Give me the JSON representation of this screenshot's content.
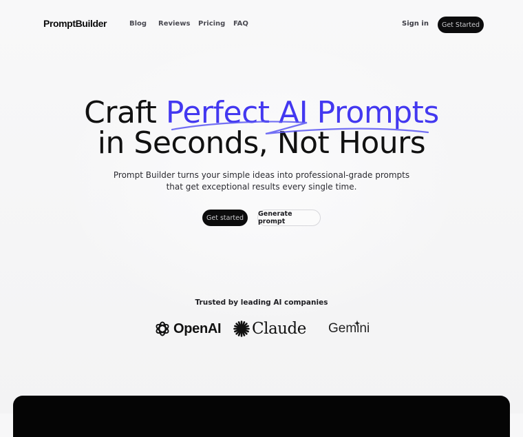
{
  "nav": {
    "logo": "PromptBuilder",
    "links": [
      {
        "label": "Blog"
      },
      {
        "label": "Reviews"
      },
      {
        "label": "Pricing"
      },
      {
        "label": "FAQ"
      }
    ],
    "sign_in": "Sign in",
    "cta": "Get Started"
  },
  "hero": {
    "title_pre": "Craft",
    "title_accent": "Perfect AI Prompts",
    "title_line2": "in Seconds, Not Hours",
    "subtitle": "Prompt Builder turns your simple ideas into professional-grade prompts that get exceptional results every single time.",
    "primary_button": "Get started",
    "secondary_button": "Generate prompt"
  },
  "trusted": {
    "heading": "Trusted by leading AI companies",
    "brands": [
      {
        "name": "OpenAI",
        "icon": "openai-logo-icon"
      },
      {
        "name": "Claude",
        "icon": "claude-starburst-icon"
      },
      {
        "name": "Gemini",
        "icon": "gemini-sparkle-icon"
      }
    ]
  },
  "colors": {
    "accent": "#4338f0",
    "dark_button": "#0c0c0d",
    "background": "#f7f7f8"
  }
}
